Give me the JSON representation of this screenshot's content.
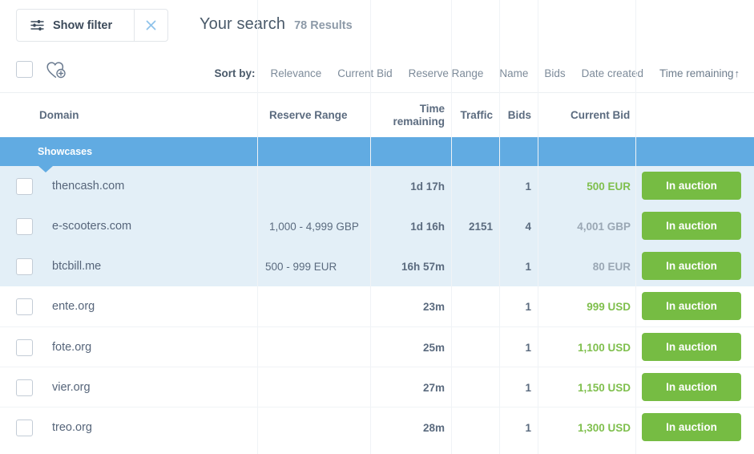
{
  "toolbar": {
    "filter_label": "Show filter",
    "filter_icon": "sliders-icon",
    "close_icon": "close-icon",
    "search_title": "Your search",
    "results_count": "78 Results"
  },
  "bulk": {
    "select_all_icon": "checkbox-icon",
    "watchlist_icon": "heart-plus-icon"
  },
  "sort": {
    "label": "Sort by:",
    "options": [
      {
        "label": "Relevance",
        "active": false
      },
      {
        "label": "Current Bid",
        "active": false
      },
      {
        "label": "Reserve Range",
        "active": false
      },
      {
        "label": "Name",
        "active": false
      },
      {
        "label": "Bids",
        "active": false
      },
      {
        "label": "Date created",
        "active": false
      },
      {
        "label": "Time remaining",
        "active": true
      }
    ],
    "active_arrow": "↑"
  },
  "table": {
    "columns": [
      {
        "label": "Domain"
      },
      {
        "label": "Reserve Range"
      },
      {
        "label": "Time remaining"
      },
      {
        "label": "Traffic"
      },
      {
        "label": "Bids"
      },
      {
        "label": "Current Bid"
      }
    ],
    "showcase_band_label": "Showcases",
    "action_label": "In auction",
    "showcase_rows": [
      {
        "domain": "thencash.com",
        "reserve": "",
        "time": "1d 17h",
        "traffic": "",
        "bids": "1",
        "bid": "500 EUR",
        "bid_color": "green",
        "action": "In auction"
      },
      {
        "domain": "e-scooters.com",
        "reserve": "1,000 - 4,999 GBP",
        "time": "1d 16h",
        "traffic": "2151",
        "bids": "4",
        "bid": "4,001 GBP",
        "bid_color": "grey",
        "action": "In auction"
      },
      {
        "domain": "btcbill.me",
        "reserve": "500 - 999 EUR",
        "time": "16h 57m",
        "traffic": "",
        "bids": "1",
        "bid": "80 EUR",
        "bid_color": "grey",
        "action": "In auction"
      }
    ],
    "rows": [
      {
        "domain": "ente.org",
        "reserve": "",
        "time": "23m",
        "traffic": "",
        "bids": "1",
        "bid": "999 USD",
        "bid_color": "green",
        "action": "In auction"
      },
      {
        "domain": "fote.org",
        "reserve": "",
        "time": "25m",
        "traffic": "",
        "bids": "1",
        "bid": "1,100 USD",
        "bid_color": "green",
        "action": "In auction"
      },
      {
        "domain": "vier.org",
        "reserve": "",
        "time": "27m",
        "traffic": "",
        "bids": "1",
        "bid": "1,150 USD",
        "bid_color": "green",
        "action": "In auction"
      },
      {
        "domain": "treo.org",
        "reserve": "",
        "time": "28m",
        "traffic": "",
        "bids": "1",
        "bid": "1,300 USD",
        "bid_color": "green",
        "action": "In auction"
      }
    ]
  },
  "colors": {
    "accent_blue": "#61abe2",
    "action_green": "#76bc43",
    "bid_green": "#7fbf4d",
    "showcase_bg": "#e3eff7",
    "text": "#5b6b7f"
  }
}
